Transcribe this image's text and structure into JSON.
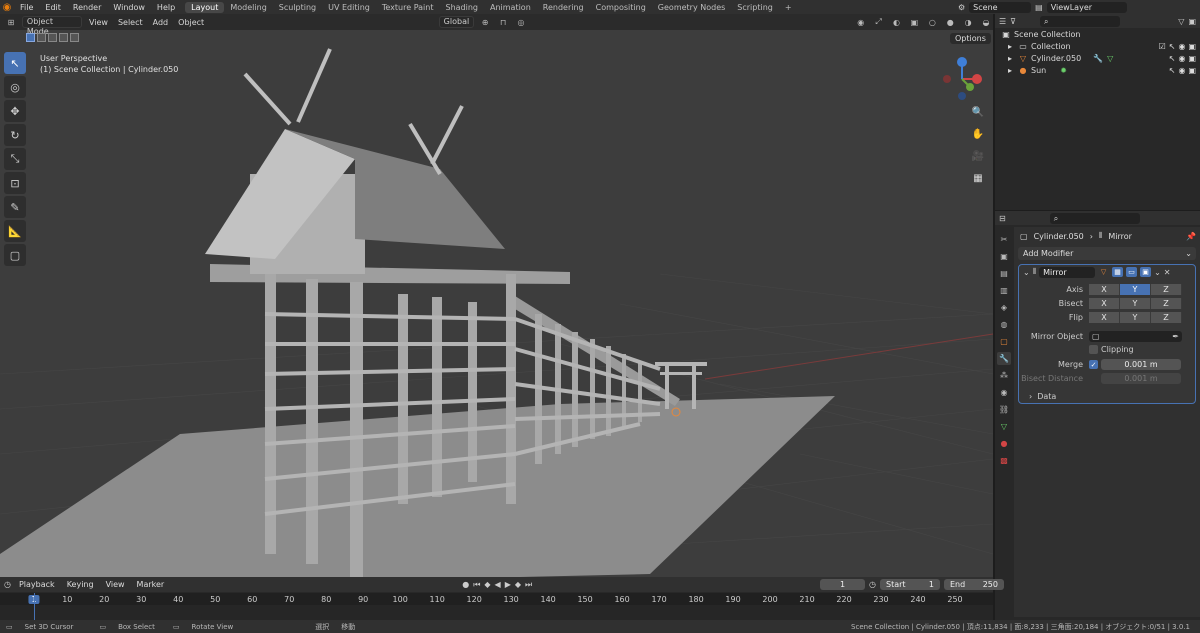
{
  "menu": {
    "items": [
      "File",
      "Edit",
      "Render",
      "Window",
      "Help"
    ]
  },
  "workspaces": [
    "Layout",
    "Modeling",
    "Sculpting",
    "UV Editing",
    "Texture Paint",
    "Shading",
    "Animation",
    "Rendering",
    "Compositing",
    "Geometry Nodes",
    "Scripting"
  ],
  "topright": {
    "scene": "Scene",
    "view_layer": "ViewLayer"
  },
  "viewport": {
    "mode": "Object Mode",
    "menus": [
      "View",
      "Select",
      "Add",
      "Object"
    ],
    "transform_orientation": "Global",
    "options_label": "Options",
    "label_line1": "User Perspective",
    "label_line2": "(1) Scene Collection | Cylinder.050"
  },
  "outliner": {
    "root": "Scene Collection",
    "rows": [
      {
        "label": "Collection",
        "icon": "collection-icon"
      },
      {
        "label": "Cylinder.050",
        "icon": "mesh-object-icon"
      },
      {
        "label": "Sun",
        "icon": "light-icon"
      }
    ]
  },
  "properties": {
    "breadcrumb_object": "Cylinder.050",
    "breadcrumb_modifier": "Mirror",
    "add_modifier": "Add Modifier",
    "modifier_name": "Mirror",
    "labels": {
      "axis": "Axis",
      "bisect": "Bisect",
      "flip": "Flip",
      "mirror_object": "Mirror Object",
      "clipping": "Clipping",
      "merge": "Merge",
      "bisect_distance": "Bisect Distance",
      "data": "Data"
    },
    "xyz": [
      "X",
      "Y",
      "Z"
    ],
    "merge_value": "0.001 m",
    "bisect_distance_value": "0.001 m"
  },
  "timeline": {
    "menus": [
      "Playback",
      "Keying",
      "View",
      "Marker"
    ],
    "current_frame": "1",
    "start_label": "Start",
    "start_value": "1",
    "end_label": "End",
    "end_value": "250",
    "ticks": [
      "1",
      "10",
      "20",
      "30",
      "40",
      "50",
      "60",
      "70",
      "80",
      "90",
      "100",
      "110",
      "120",
      "130",
      "140",
      "150",
      "160",
      "170",
      "180",
      "190",
      "200",
      "210",
      "220",
      "230",
      "240",
      "250"
    ]
  },
  "status": {
    "set_cursor": "Set 3D Cursor",
    "box_select": "Box Select",
    "rotate_view": "Rotate View",
    "select_jp": "選択",
    "move_jp": "移動",
    "info": "Scene Collection | Cylinder.050 | 頂点:11,834 | 面:8,233 | 三角面:20,184 | オブジェクト:0/51 | 3.0.1"
  },
  "colors": {
    "accent": "#4772b3",
    "viewport_bg": "#3d3d3d",
    "header": "#303030",
    "panel": "#282828"
  }
}
